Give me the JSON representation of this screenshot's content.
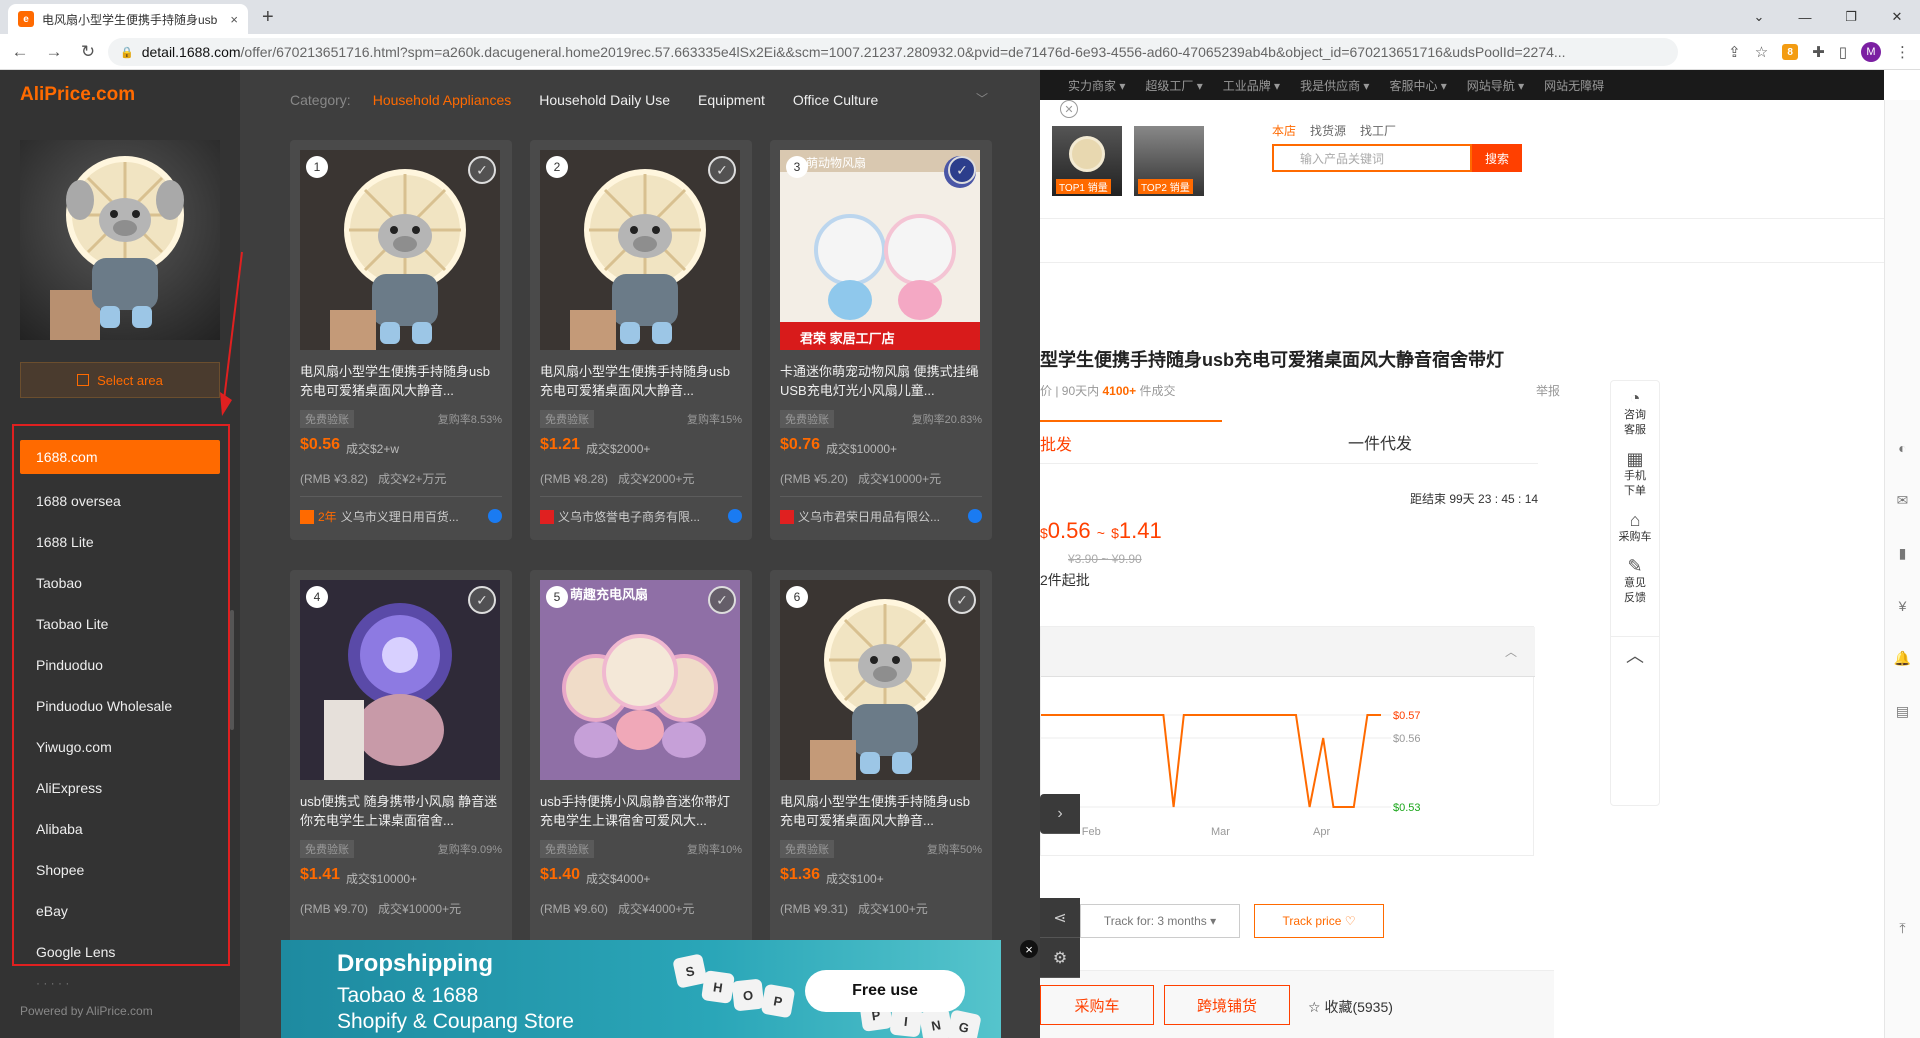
{
  "browser": {
    "tab_title": "电风扇小型学生便携手持随身usb",
    "tab_close": "×",
    "new_tab": "+",
    "url_host": "detail.1688.com",
    "url_rest": "/offer/670213651716.html?spm=a260k.dacugeneral.home2019rec.57.663335e4lSx2Ei&&scm=1007.21237.280932.0&pvid=de71476d-6e93-4556-ad60-47065239ab4b&object_id=670213651716&udsPoolId=2274...",
    "ext_badge": "8",
    "profile_initial": "M"
  },
  "aliprice": {
    "logo": "AliPrice.com",
    "select_area": "Select area",
    "powered": "Powered by AliPrice.com",
    "more_hint": "· · · · ·",
    "sites": [
      "1688.com",
      "1688 oversea",
      "1688 Lite",
      "Taobao",
      "Taobao Lite",
      "Pinduoduo",
      "Pinduoduo Wholesale",
      "Yiwugo.com",
      "AliExpress",
      "Alibaba",
      "Shopee",
      "eBay",
      "Google Lens"
    ],
    "active_site": 0,
    "category_label": "Category:",
    "categories": [
      "Household Appliances",
      "Household Daily Use",
      "Equipment",
      "Office Culture"
    ],
    "active_category": 0
  },
  "products": [
    {
      "n": "1",
      "title": "电风扇小型学生便携手持随身usb充电可爱猪桌面风大静音...",
      "badge": "免费验账",
      "repurchase": "复购率8.53%",
      "price": "$0.56",
      "sold": "成交$2+w",
      "rmb": "(RMB ¥3.82)",
      "rmb_sold": "成交¥2+万元",
      "shop": "义乌市义理日用百货...",
      "shop_year": "2年"
    },
    {
      "n": "2",
      "title": "电风扇小型学生便携手持随身usb充电可爱猪桌面风大静音...",
      "badge": "免费验账",
      "repurchase": "复购率15%",
      "price": "$1.21",
      "sold": "成交$2000+",
      "rmb": "(RMB ¥8.28)",
      "rmb_sold": "成交¥2000+元",
      "shop": "义乌市悠誉电子商务有限...",
      "shop_year": ""
    },
    {
      "n": "3",
      "title": "卡通迷你萌宠动物风扇 便携式挂绳USB充电灯光小风扇儿童...",
      "badge": "免费验账",
      "repurchase": "复购率20.83%",
      "price": "$0.76",
      "sold": "成交$10000+",
      "rmb": "(RMB ¥5.20)",
      "rmb_sold": "成交¥10000+元",
      "shop": "义乌市君荣日用品有限公...",
      "shop_year": ""
    },
    {
      "n": "4",
      "title": "usb便携式 随身携带小风扇 静音迷你充电学生上课桌面宿舍...",
      "badge": "免费验账",
      "repurchase": "复购率9.09%",
      "price": "$1.41",
      "sold": "成交$10000+",
      "rmb": "(RMB ¥9.70)",
      "rmb_sold": "成交¥10000+元"
    },
    {
      "n": "5",
      "title": "usb手持便携小风扇静音迷你带灯充电学生上课宿舍可爱风大...",
      "badge": "免费验账",
      "repurchase": "复购率10%",
      "price": "$1.40",
      "sold": "成交$4000+",
      "rmb": "(RMB ¥9.60)",
      "rmb_sold": "成交¥4000+元"
    },
    {
      "n": "6",
      "title": "电风扇小型学生便携手持随身usb充电可爱猪桌面风大静音...",
      "badge": "免费验账",
      "repurchase": "复购率50%",
      "price": "$1.36",
      "sold": "成交$100+",
      "rmb": "(RMB ¥9.31)",
      "rmb_sold": "成交¥100+元"
    }
  ],
  "card3_img_text": {
    "top": "萌动物风扇",
    "bottom": "君荣  家居工厂店"
  },
  "card5_img_text": "萌趣充电风扇",
  "ad": {
    "line1": "Dropshipping",
    "line2": "Taobao & 1688",
    "line3": "Shopify & Coupang Store",
    "cta": "Free use",
    "dice": [
      "S",
      "H",
      "O",
      "P",
      "P",
      "I",
      "N",
      "G"
    ]
  },
  "bg": {
    "topnav": [
      "实力商家 ▾",
      "超级工厂 ▾",
      "工业品牌 ▾",
      "我是供应商 ▾",
      "客服中心 ▾",
      "网站导航 ▾",
      "网站无障碍"
    ],
    "thumb_labels": [
      "TOP1 销量",
      "TOP2 销量"
    ],
    "search_tabs": [
      "本店",
      "找货源",
      "找工厂"
    ],
    "search_placeholder": "输入产品关键词",
    "search_btn": "搜索",
    "title": "型学生便携手持随身usb充电可爱猪桌面风大静音宿舍带灯",
    "stat_prefix": "价 | 90天内",
    "stat_value": "4100+",
    "stat_suffix": "件成交",
    "report": "举报",
    "tab_wholesale": "批发",
    "tab_dropship": "一件代发",
    "countdown": "距结束 99天 23 : 45 : 14",
    "price_lo": "0.56",
    "price_hi": "1.41",
    "price_sep": "~",
    "currency": "$",
    "old_price": "¥3.90 ~ ¥9.90",
    "min_qty": "2件起批",
    "track_for": "Track for: 3 months",
    "track_price": "Track price ♡",
    "btn_cart": "采购车",
    "btn_cross": "跨境铺货",
    "fav": "☆ 收藏(5935)",
    "svc": [
      {
        "icon": "◔",
        "label": "咨询客服"
      },
      {
        "icon": "▦",
        "label": "手机下单"
      },
      {
        "icon": "⌂",
        "label": "采购车"
      },
      {
        "icon": "✎",
        "label": "意见反馈"
      }
    ]
  },
  "chart_data": {
    "type": "line",
    "x_ticks": [
      "Feb",
      "Mar",
      "Apr"
    ],
    "y_ticks": [
      "$0.57",
      "$0.56",
      "$0.53"
    ],
    "ylim": [
      0.53,
      0.57
    ],
    "points": [
      [
        0,
        0.57
      ],
      [
        0.36,
        0.57
      ],
      [
        0.39,
        0.53
      ],
      [
        0.42,
        0.57
      ],
      [
        0.75,
        0.57
      ],
      [
        0.79,
        0.53
      ],
      [
        0.83,
        0.56
      ],
      [
        0.86,
        0.53
      ],
      [
        0.92,
        0.53
      ],
      [
        0.96,
        0.57
      ],
      [
        1.0,
        0.57
      ]
    ],
    "line_color": "#ff6a00",
    "low_color": "#1aa61a",
    "high_color": "#ff4000"
  }
}
